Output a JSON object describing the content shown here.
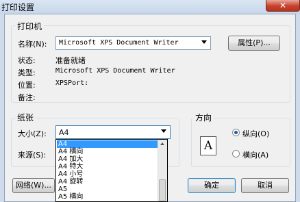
{
  "window": {
    "title": "打印设置",
    "close_symbol": "✕"
  },
  "printer": {
    "group_label": "打印机",
    "name_label": "名称(N):",
    "name_value": "Microsoft XPS Document Writer",
    "properties_button": "属性(P)...",
    "status_label": "状态:",
    "status_value": "准备就绪",
    "type_label": "类型:",
    "type_value": "Microsoft XPS Document Writer",
    "location_label": "位置:",
    "location_value": "XPSPort:",
    "comment_label": "备注:"
  },
  "paper": {
    "group_label": "纸张",
    "size_label": "大小(Z):",
    "size_value": "A4",
    "source_label": "来源(S):",
    "size_options": [
      "A4",
      "A4 横向",
      "A4 加大",
      "A4 特大",
      "A4 小号",
      "A4 旋转",
      "A5",
      "A5 横向"
    ],
    "selected_index": 0
  },
  "orientation": {
    "group_label": "方向",
    "icon_letter": "A",
    "portrait_label": "纵向(O)",
    "landscape_label": "横向(A)",
    "selected": "portrait"
  },
  "buttons": {
    "network": "网络(W)...",
    "ok": "确定",
    "cancel": "取消"
  }
}
